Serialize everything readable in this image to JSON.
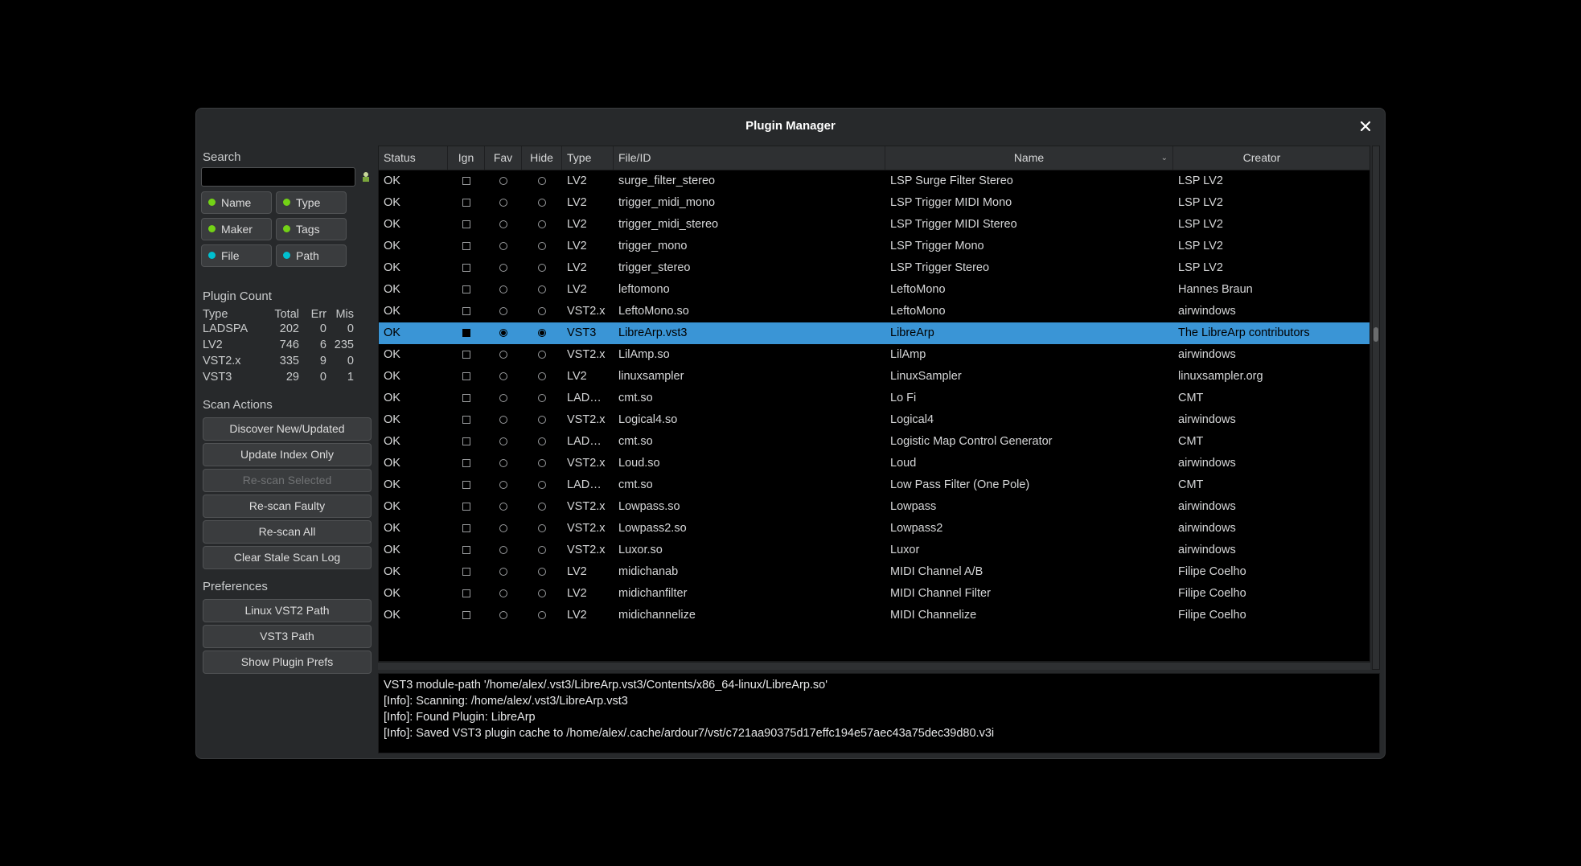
{
  "window": {
    "title": "Plugin Manager"
  },
  "sidebar": {
    "search_label": "Search",
    "toggles": [
      {
        "label": "Name",
        "style": "green"
      },
      {
        "label": "Type",
        "style": "green"
      },
      {
        "label": "Maker",
        "style": "green"
      },
      {
        "label": "Tags",
        "style": "green"
      },
      {
        "label": "File",
        "style": "alt"
      },
      {
        "label": "Path",
        "style": "alt"
      }
    ],
    "count_label": "Plugin Count",
    "count_headers": [
      "Type",
      "Total",
      "Err",
      "Mis"
    ],
    "counts": [
      {
        "type": "LADSPA",
        "total": "202",
        "err": "0",
        "mis": "0"
      },
      {
        "type": "LV2",
        "total": "746",
        "err": "6",
        "mis": "235"
      },
      {
        "type": "VST2.x",
        "total": "335",
        "err": "9",
        "mis": "0"
      },
      {
        "type": "VST3",
        "total": "29",
        "err": "0",
        "mis": "1"
      }
    ],
    "scan_label": "Scan Actions",
    "scan_buttons": [
      {
        "label": "Discover New/Updated",
        "disabled": false
      },
      {
        "label": "Update Index Only",
        "disabled": false
      },
      {
        "label": "Re-scan Selected",
        "disabled": true
      },
      {
        "label": "Re-scan Faulty",
        "disabled": false
      },
      {
        "label": "Re-scan All",
        "disabled": false
      },
      {
        "label": "Clear Stale Scan Log",
        "disabled": false
      }
    ],
    "prefs_label": "Preferences",
    "prefs_buttons": [
      {
        "label": "Linux VST2 Path"
      },
      {
        "label": "VST3 Path"
      },
      {
        "label": "Show Plugin Prefs"
      }
    ]
  },
  "columns": {
    "status": "Status",
    "ign": "Ign",
    "fav": "Fav",
    "hide": "Hide",
    "type": "Type",
    "file": "File/ID",
    "name": "Name",
    "creator": "Creator"
  },
  "rows": [
    {
      "status": "OK",
      "ign": false,
      "fav": false,
      "hide": false,
      "type": "LV2",
      "file": "surge_filter_stereo",
      "name": "LSP Surge Filter Stereo",
      "creator": "LSP LV2",
      "sel": false
    },
    {
      "status": "OK",
      "ign": false,
      "fav": false,
      "hide": false,
      "type": "LV2",
      "file": "trigger_midi_mono",
      "name": "LSP Trigger MIDI Mono",
      "creator": "LSP LV2",
      "sel": false
    },
    {
      "status": "OK",
      "ign": false,
      "fav": false,
      "hide": false,
      "type": "LV2",
      "file": "trigger_midi_stereo",
      "name": "LSP Trigger MIDI Stereo",
      "creator": "LSP LV2",
      "sel": false
    },
    {
      "status": "OK",
      "ign": false,
      "fav": false,
      "hide": false,
      "type": "LV2",
      "file": "trigger_mono",
      "name": "LSP Trigger Mono",
      "creator": "LSP LV2",
      "sel": false
    },
    {
      "status": "OK",
      "ign": false,
      "fav": false,
      "hide": false,
      "type": "LV2",
      "file": "trigger_stereo",
      "name": "LSP Trigger Stereo",
      "creator": "LSP LV2",
      "sel": false
    },
    {
      "status": "OK",
      "ign": false,
      "fav": false,
      "hide": false,
      "type": "LV2",
      "file": "leftomono",
      "name": "LeftoMono",
      "creator": "Hannes Braun",
      "sel": false
    },
    {
      "status": "OK",
      "ign": false,
      "fav": false,
      "hide": false,
      "type": "VST2.x",
      "file": "LeftoMono.so",
      "name": "LeftoMono",
      "creator": "airwindows",
      "sel": false
    },
    {
      "status": "OK",
      "ign": true,
      "fav": true,
      "hide": true,
      "type": "VST3",
      "file": "LibreArp.vst3",
      "name": "LibreArp",
      "creator": "The LibreArp contributors",
      "sel": true
    },
    {
      "status": "OK",
      "ign": false,
      "fav": false,
      "hide": false,
      "type": "VST2.x",
      "file": "LilAmp.so",
      "name": "LilAmp",
      "creator": "airwindows",
      "sel": false
    },
    {
      "status": "OK",
      "ign": false,
      "fav": false,
      "hide": false,
      "type": "LV2",
      "file": "linuxsampler",
      "name": "LinuxSampler",
      "creator": "linuxsampler.org",
      "sel": false
    },
    {
      "status": "OK",
      "ign": false,
      "fav": false,
      "hide": false,
      "type": "LADSPA",
      "file": "cmt.so",
      "name": "Lo Fi",
      "creator": "CMT",
      "sel": false
    },
    {
      "status": "OK",
      "ign": false,
      "fav": false,
      "hide": false,
      "type": "VST2.x",
      "file": "Logical4.so",
      "name": "Logical4",
      "creator": "airwindows",
      "sel": false
    },
    {
      "status": "OK",
      "ign": false,
      "fav": false,
      "hide": false,
      "type": "LADSPA",
      "file": "cmt.so",
      "name": "Logistic Map Control Generator",
      "creator": "CMT",
      "sel": false
    },
    {
      "status": "OK",
      "ign": false,
      "fav": false,
      "hide": false,
      "type": "VST2.x",
      "file": "Loud.so",
      "name": "Loud",
      "creator": "airwindows",
      "sel": false
    },
    {
      "status": "OK",
      "ign": false,
      "fav": false,
      "hide": false,
      "type": "LADSPA",
      "file": "cmt.so",
      "name": "Low Pass Filter (One Pole)",
      "creator": "CMT",
      "sel": false
    },
    {
      "status": "OK",
      "ign": false,
      "fav": false,
      "hide": false,
      "type": "VST2.x",
      "file": "Lowpass.so",
      "name": "Lowpass",
      "creator": "airwindows",
      "sel": false
    },
    {
      "status": "OK",
      "ign": false,
      "fav": false,
      "hide": false,
      "type": "VST2.x",
      "file": "Lowpass2.so",
      "name": "Lowpass2",
      "creator": "airwindows",
      "sel": false
    },
    {
      "status": "OK",
      "ign": false,
      "fav": false,
      "hide": false,
      "type": "VST2.x",
      "file": "Luxor.so",
      "name": "Luxor",
      "creator": "airwindows",
      "sel": false
    },
    {
      "status": "OK",
      "ign": false,
      "fav": false,
      "hide": false,
      "type": "LV2",
      "file": "midichanab",
      "name": "MIDI Channel A/B",
      "creator": "Filipe Coelho",
      "sel": false
    },
    {
      "status": "OK",
      "ign": false,
      "fav": false,
      "hide": false,
      "type": "LV2",
      "file": "midichanfilter",
      "name": "MIDI Channel Filter",
      "creator": "Filipe Coelho",
      "sel": false
    },
    {
      "status": "OK",
      "ign": false,
      "fav": false,
      "hide": false,
      "type": "LV2",
      "file": "midichannelize",
      "name": "MIDI Channelize",
      "creator": "Filipe Coelho",
      "sel": false
    }
  ],
  "log_lines": [
    "VST3 module-path '/home/alex/.vst3/LibreArp.vst3/Contents/x86_64-linux/LibreArp.so'",
    "[Info]: Scanning: /home/alex/.vst3/LibreArp.vst3",
    "[Info]: Found Plugin: LibreArp",
    "[Info]: Saved VST3 plugin cache to /home/alex/.cache/ardour7/vst/c721aa90375d17effc194e57aec43a75dec39d80.v3i"
  ]
}
